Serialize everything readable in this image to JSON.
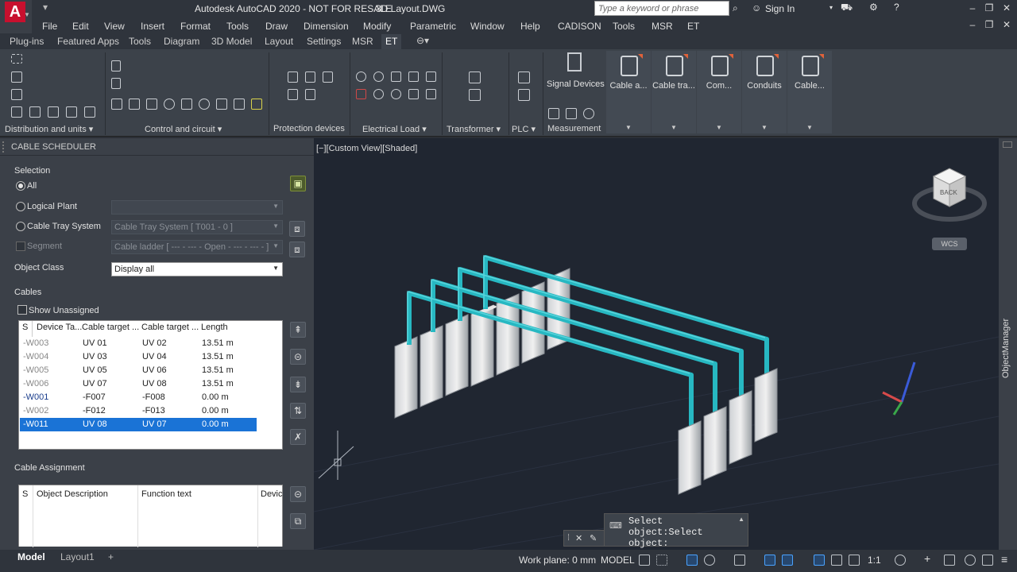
{
  "app": {
    "title": "Autodesk AutoCAD 2020 - NOT FOR RESALE",
    "document": "3D Layout.DWG",
    "logo_letter": "A",
    "search_placeholder": "Type a keyword or phrase",
    "sign_in": "Sign In"
  },
  "menu": [
    "File",
    "Edit",
    "View",
    "Insert",
    "Format",
    "Tools",
    "Draw",
    "Dimension",
    "Modify",
    "Parametric",
    "Window",
    "Help",
    "CADISON",
    "Tools",
    "MSR",
    "ET"
  ],
  "ribbon_tabs": [
    "Plug-ins",
    "Featured Apps",
    "Tools",
    "Diagram",
    "3D Model",
    "Layout",
    "Settings",
    "MSR",
    "ET"
  ],
  "ribbon_panels": {
    "distribution": "Distribution and units",
    "control": "Control and circuit",
    "protection": "Protection devices",
    "electrical": "Electrical Load",
    "transformer": "Transformer",
    "plc": "PLC",
    "measurement": "Measurement"
  },
  "ribbon_big_buttons": [
    "Signal Devices",
    "Cable a...",
    "Cable tra...",
    "Com...",
    "Conduits",
    "Cable..."
  ],
  "palette": {
    "title": "CABLE SCHEDULER",
    "selection_label": "Selection",
    "radio_all": "All",
    "radio_logical": "Logical Plant",
    "radio_tray": "Cable Tray System",
    "segment": "Segment",
    "tray_value": "Cable Tray System    [ T001 - 0 ]",
    "segment_value": "Cable ladder    [ --- - --- - Open - --- - --- - ]",
    "object_class_label": "Object Class",
    "object_class_value": "Display all",
    "cables_label": "Cables",
    "show_unassigned": "Show Unassigned",
    "cables_columns": [
      "S",
      "Device Ta...",
      "Cable target ...",
      "Cable target ...",
      "Length"
    ],
    "cables_rows": [
      {
        "id": "-W003",
        "a": "UV 01",
        "b": "UV 02",
        "len": "13.51 m",
        "dim": true
      },
      {
        "id": "-W004",
        "a": "UV 03",
        "b": "UV 04",
        "len": "13.51 m",
        "dim": true
      },
      {
        "id": "-W005",
        "a": "UV 05",
        "b": "UV 06",
        "len": "13.51 m",
        "dim": true
      },
      {
        "id": "-W006",
        "a": "UV 07",
        "b": "UV 08",
        "len": "13.51 m",
        "dim": true
      },
      {
        "id": "-W001",
        "a": "-F007",
        "b": "-F008",
        "len": "0.00 m",
        "dim": false
      },
      {
        "id": "-W002",
        "a": "-F012",
        "b": "-F013",
        "len": "0.00 m",
        "dim": true
      },
      {
        "id": "-W011",
        "a": "UV 08",
        "b": "UV 07",
        "len": "0.00 m",
        "selected": true
      }
    ],
    "assignment_label": "Cable Assignment",
    "assignment_columns": [
      "S",
      "Object Description",
      "Function text",
      "Device"
    ]
  },
  "viewport": {
    "label": "[−][Custom View][Shaded]",
    "viewcube_face": "BACK",
    "wcs": "WCS",
    "object_manager": "ObjectManager",
    "pipe_color": "#27b8c2"
  },
  "command": {
    "text": "Select object:Select object:"
  },
  "layout_tabs": [
    "Model",
    "Layout1"
  ],
  "status": {
    "work_plane": "Work plane: 0 mm",
    "model": "MODEL",
    "scale": "1:1"
  }
}
